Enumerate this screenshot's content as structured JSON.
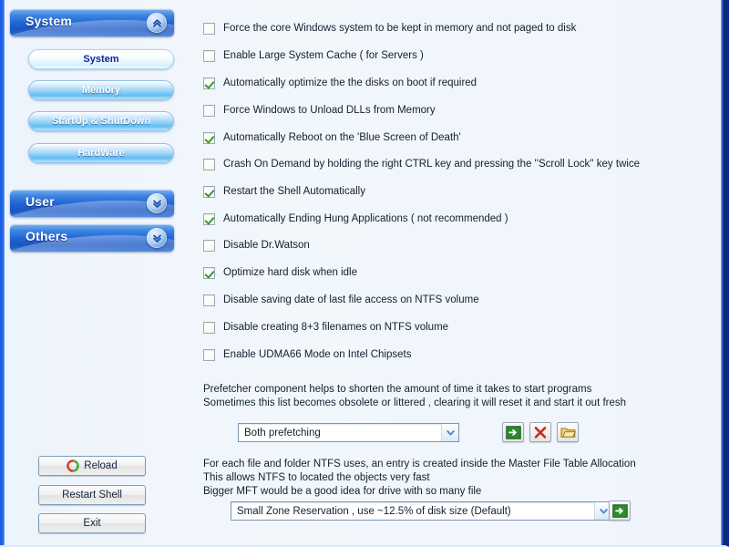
{
  "theme": {
    "accent_blue": "#1f64d4",
    "rail_left": "#1f63e6",
    "rail_right": "#06205f",
    "background": "#eef4fb",
    "check_green": "#2f9b33",
    "active_nav_text": "#12239b"
  },
  "sidebar": {
    "groups": [
      {
        "label": "System",
        "expanded": true,
        "chevron_icon": "chevron-double-up-icon"
      },
      {
        "label": "User",
        "expanded": false,
        "chevron_icon": "chevron-double-down-icon"
      },
      {
        "label": "Others",
        "expanded": false,
        "chevron_icon": "chevron-double-down-icon"
      }
    ],
    "nav_items": [
      {
        "label": "System",
        "active": true
      },
      {
        "label": "Memory",
        "active": false
      },
      {
        "label": "StartUp & ShutDown",
        "active": false
      },
      {
        "label": "HardWare",
        "active": false
      }
    ],
    "actions": [
      {
        "label": "Reload",
        "icon": "refresh-icon"
      },
      {
        "label": "Restart Shell",
        "icon": ""
      },
      {
        "label": "Exit",
        "icon": ""
      }
    ]
  },
  "main": {
    "checkboxes": [
      {
        "label": "Force the core Windows system to be kept in memory and not paged to disk",
        "checked": false
      },
      {
        "label": "Enable Large System Cache ( for Servers )",
        "checked": false
      },
      {
        "label": "Automatically optimize the the disks on boot if required",
        "checked": true
      },
      {
        "label": "Force Windows to Unload DLLs from Memory",
        "checked": false
      },
      {
        "label": "Automatically Reboot on the 'Blue Screen of Death'",
        "checked": true
      },
      {
        "label": "Crash On Demand by holding the right CTRL key and pressing the ''Scroll Lock'' key twice",
        "checked": false
      },
      {
        "label": "Restart the Shell Automatically",
        "checked": true
      },
      {
        "label": "Automatically Ending Hung Applications ( not recommended )",
        "checked": true
      },
      {
        "label": "Disable Dr.Watson",
        "checked": false
      },
      {
        "label": "Optimize hard disk when idle",
        "checked": true
      },
      {
        "label": "Disable saving date of last file access on NTFS volume",
        "checked": false
      },
      {
        "label": "Disable creating 8+3 filenames on NTFS volume",
        "checked": false
      },
      {
        "label": "Enable UDMA66 Mode on Intel Chipsets",
        "checked": false
      }
    ],
    "prefetcher": {
      "description_line1": "Prefetcher component helps to shorten the amount of time it takes to start programs",
      "description_line2": "Sometimes this list becomes obsolete or littered , clearing it will reset it and start it out fresh",
      "combo_value": "Both prefetching",
      "buttons": [
        {
          "icon": "arrow-right-apply-icon",
          "tooltip": "Apply"
        },
        {
          "icon": "red-x-clear-icon",
          "tooltip": "Clear"
        },
        {
          "icon": "folder-open-icon",
          "tooltip": "Open Folder"
        }
      ]
    },
    "mft": {
      "description_line1": "For each file and folder NTFS uses, an entry is created inside the Master File Table Allocation",
      "description_line2": "This allows NTFS to located the objects very fast",
      "description_line3": "Bigger MFT would be a good idea for drive with so many file",
      "combo_value": "Small Zone Reservation , use ~12.5% of disk size (Default)",
      "buttons": [
        {
          "icon": "arrow-right-apply-icon",
          "tooltip": "Apply"
        }
      ]
    }
  }
}
